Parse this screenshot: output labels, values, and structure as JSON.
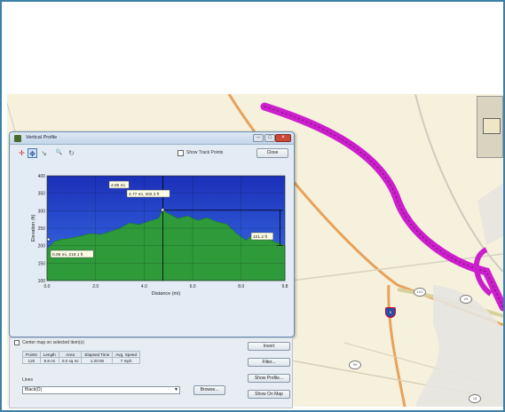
{
  "window": {
    "title": "Vertical Profile",
    "close_label": "×",
    "minimize_label": "–",
    "maximize_label": "□"
  },
  "toolbar": {
    "show_track_points_label": "Show Track Points",
    "close_button_label": "Close",
    "tools": [
      {
        "name": "select-tool-icon",
        "glyph": "✛"
      },
      {
        "name": "pan-tool-icon",
        "glyph": "✥"
      },
      {
        "name": "measure-tool-icon",
        "glyph": "↘"
      },
      {
        "name": "zoom-in-tool-icon",
        "glyph": "🔍"
      },
      {
        "name": "zoom-out-tool-icon",
        "glyph": "↻"
      }
    ]
  },
  "chart_data": {
    "type": "area",
    "xlabel": "Distance (mi)",
    "ylabel": "Elevation (ft)",
    "xlim": [
      0,
      9.8
    ],
    "ylim": [
      100,
      400
    ],
    "x_ticks": [
      "0.0",
      "2.0",
      "4.0",
      "6.0",
      "8.0",
      "9.8"
    ],
    "y_ticks": [
      "100",
      "150",
      "200",
      "250",
      "300",
      "350",
      "400"
    ],
    "series": [
      {
        "x": [
          0.0,
          0.3,
          0.6,
          1.0,
          1.4,
          1.8,
          2.2,
          2.6,
          3.0,
          3.4,
          3.8,
          4.2,
          4.6,
          4.77,
          5.0,
          5.4,
          5.8,
          6.2,
          6.6,
          7.0,
          7.4,
          7.8,
          8.2,
          8.6,
          9.0,
          9.4,
          9.8
        ],
        "y": [
          190,
          212,
          218,
          222,
          228,
          235,
          232,
          240,
          250,
          265,
          260,
          270,
          278,
          302,
          292,
          278,
          285,
          272,
          280,
          268,
          262,
          235,
          215,
          240,
          225,
          210,
          200
        ]
      }
    ],
    "annotations": [
      {
        "text": "4.86 mi",
        "x": 4.86,
        "y": 302
      },
      {
        "text": "4.77 mi, 302.3 ft",
        "x": 4.77,
        "y": 302.3
      },
      {
        "text": "0.06 mi, 218.1 ft",
        "x": 0.06,
        "y": 218.1
      },
      {
        "text": "101.2 ft",
        "x": 9.6,
        "y": 250
      }
    ],
    "cursor_x": 4.77,
    "range_marker": {
      "x": 9.6,
      "y_top": 302,
      "y_bottom": 200
    },
    "colors": {
      "sky_top": "#1b2fb8",
      "sky_bottom": "#3a73e8",
      "terrain": "#2e9a3a",
      "terrain_dark": "#1d7a2a"
    }
  },
  "lower_panel": {
    "caption": "Center map on selected item(s)",
    "table": {
      "headers": [
        "Points",
        "Length",
        "Area",
        "Elapsed Time",
        "Avg. Speed"
      ],
      "row": [
        "120",
        "9.8 mi",
        "0.0 sq mi",
        "1:20:00",
        "7 mph"
      ]
    },
    "line_label": "Lines",
    "style_value": "Black(D)",
    "browse_label": "Browse...",
    "buttons": [
      "Invert",
      "Filter...",
      "Show Profile...",
      "Show On Map"
    ]
  },
  "map": {
    "shields": [
      "29",
      "5",
      "99",
      "101",
      "18"
    ]
  }
}
